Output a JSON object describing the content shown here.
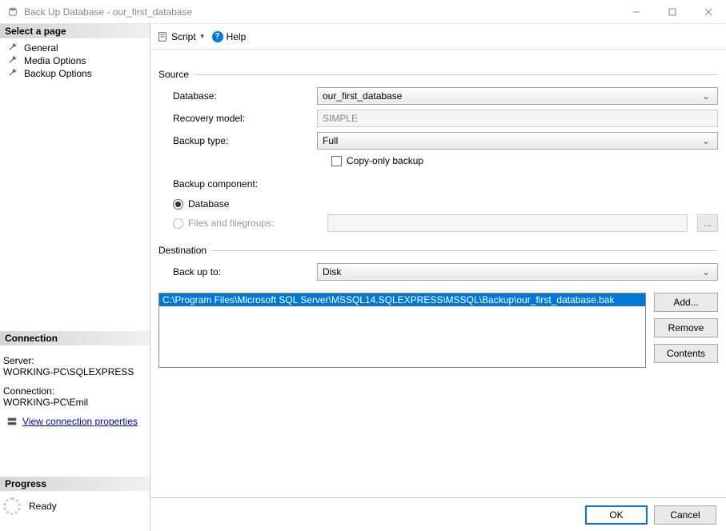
{
  "window": {
    "title": "Back Up Database - our_first_database"
  },
  "sidebar": {
    "select_page_header": "Select a page",
    "pages": [
      {
        "label": "General"
      },
      {
        "label": "Media Options"
      },
      {
        "label": "Backup Options"
      }
    ],
    "connection_header": "Connection",
    "server_label": "Server:",
    "server_value": "WORKING-PC\\SQLEXPRESS",
    "connection_label": "Connection:",
    "connection_value": "WORKING-PC\\Emil",
    "view_connection_properties": "View connection properties",
    "progress_header": "Progress",
    "progress_status": "Ready"
  },
  "toolbar": {
    "script_label": "Script",
    "help_label": "Help"
  },
  "form": {
    "source_label": "Source",
    "database_label": "Database:",
    "database_value": "our_first_database",
    "recovery_model_label": "Recovery model:",
    "recovery_model_value": "SIMPLE",
    "backup_type_label": "Backup type:",
    "backup_type_value": "Full",
    "copy_only_label": "Copy-only backup",
    "backup_component_label": "Backup component:",
    "radio_database": "Database",
    "radio_files": "Files and filegroups:",
    "ellipsis": "...",
    "destination_label": "Destination",
    "backup_to_label": "Back up to:",
    "backup_to_value": "Disk",
    "destination_path": "C:\\Program Files\\Microsoft SQL Server\\MSSQL14.SQLEXPRESS\\MSSQL\\Backup\\our_first_database.bak",
    "add_btn": "Add...",
    "remove_btn": "Remove",
    "contents_btn": "Contents"
  },
  "buttons": {
    "ok": "OK",
    "cancel": "Cancel"
  }
}
